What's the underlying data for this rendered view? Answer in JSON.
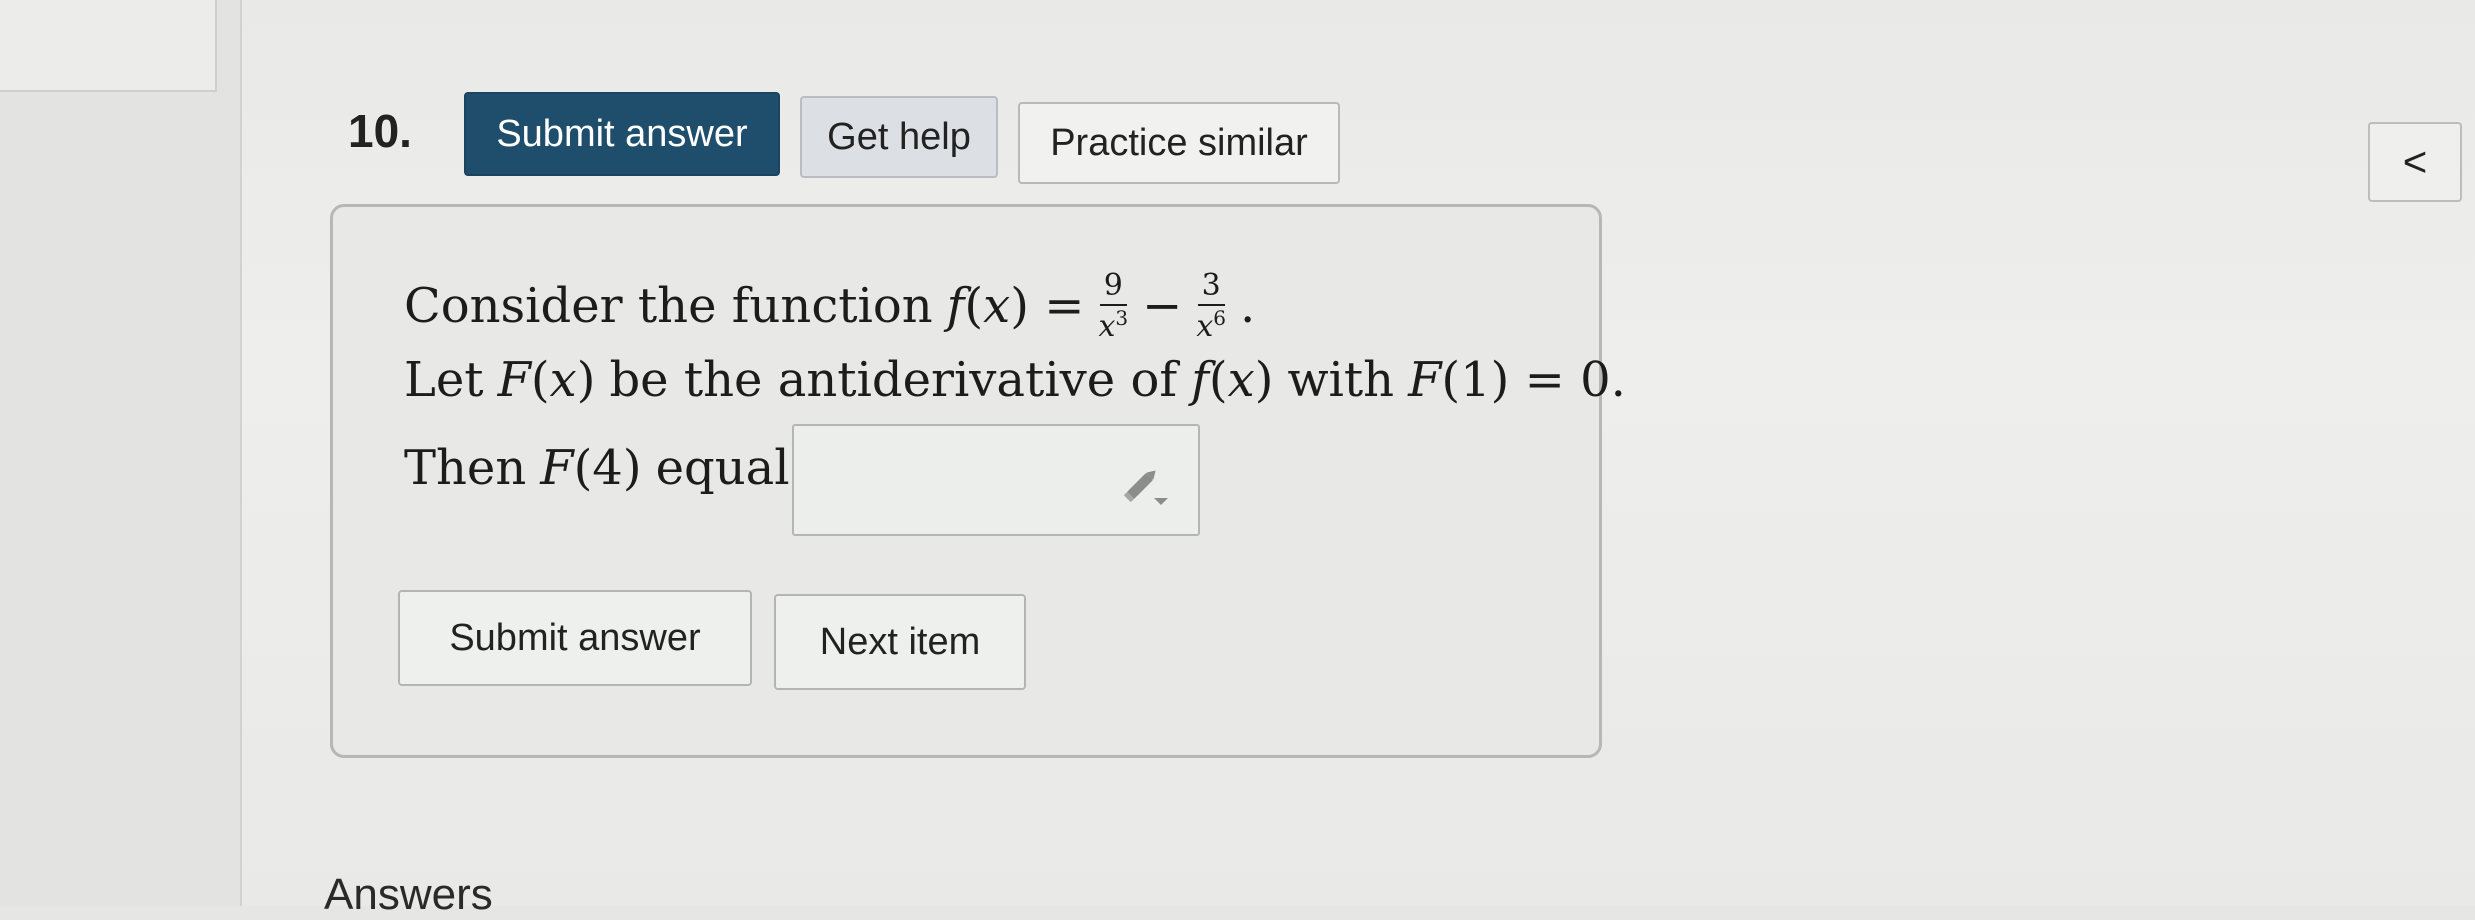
{
  "question": {
    "number": "10.",
    "line1_text": "Consider the function",
    "line2_pre": "Let",
    "line2_mid": "be the antiderivative of",
    "line2_with": "with",
    "line3_text": "Then",
    "line3_equals": "equals"
  },
  "toolbar": {
    "submit_label": "Submit answer",
    "help_label": "Get help",
    "practice_label": "Practice similar"
  },
  "nav": {
    "back_symbol": "<"
  },
  "answer": {
    "value": ""
  },
  "footer_buttons": {
    "submit_label": "Submit answer",
    "next_label": "Next item"
  },
  "section": {
    "answers_heading": "Answers"
  },
  "colors": {
    "primary": "#1f4e6c",
    "help_bg": "#dcdfe3"
  },
  "icons": {
    "answer_input": "pencil-dropdown-icon",
    "back": "chevron-left-icon"
  }
}
